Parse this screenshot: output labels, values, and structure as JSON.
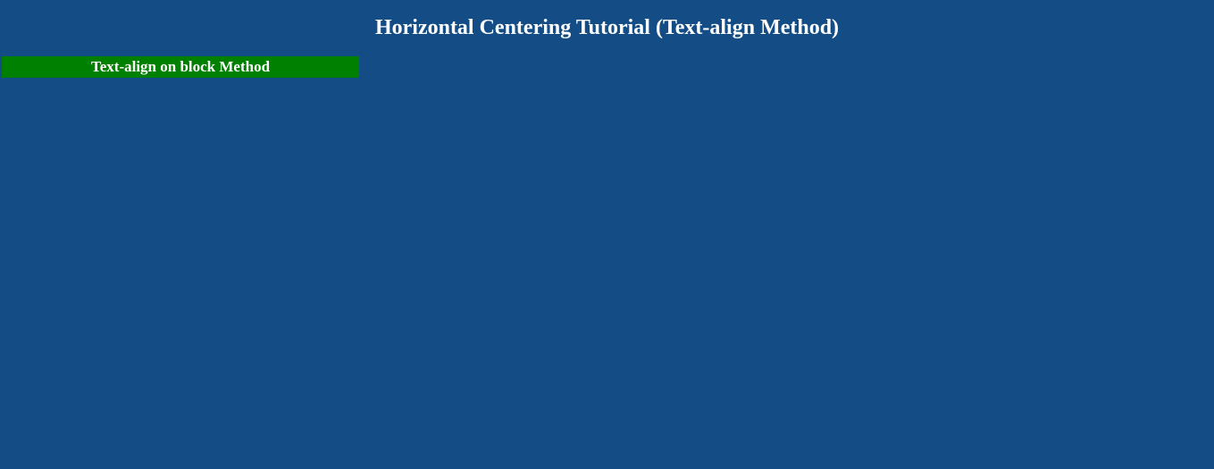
{
  "header": {
    "title": "Horizontal Centering Tutorial (Text-align Method)"
  },
  "method": {
    "label": "Text-align on block Method"
  },
  "colors": {
    "background": "#144c85",
    "method_bg": "#008000",
    "text": "#ffffff"
  }
}
